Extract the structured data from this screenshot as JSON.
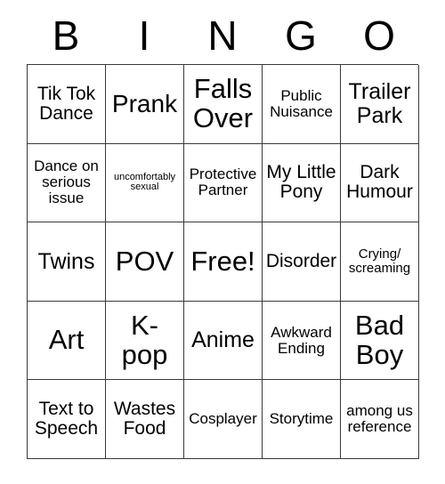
{
  "card": {
    "header_letters": [
      "B",
      "I",
      "N",
      "G",
      "O"
    ],
    "rows": [
      [
        {
          "text": "Tik Tok Dance",
          "size": "md"
        },
        {
          "text": "Prank",
          "size": "xl"
        },
        {
          "text": "Falls Over",
          "size": "xxl"
        },
        {
          "text": "Public Nuisance",
          "size": "sm"
        },
        {
          "text": "Trailer Park",
          "size": "lg"
        }
      ],
      [
        {
          "text": "Dance on serious issue",
          "size": "sm"
        },
        {
          "text": "uncomfortably sexual",
          "size": "xxs"
        },
        {
          "text": "Protective Partner",
          "size": "sm"
        },
        {
          "text": "My Little Pony",
          "size": "md"
        },
        {
          "text": "Dark Humour",
          "size": "md"
        }
      ],
      [
        {
          "text": "Twins",
          "size": "lg"
        },
        {
          "text": "POV",
          "size": "xxl"
        },
        {
          "text": "Free!",
          "size": "xxl"
        },
        {
          "text": "Disorder",
          "size": "md"
        },
        {
          "text": "Crying/ screaming",
          "size": "xs"
        }
      ],
      [
        {
          "text": "Art",
          "size": "xxl"
        },
        {
          "text": "K- pop",
          "size": "xxl"
        },
        {
          "text": "Anime",
          "size": "lg"
        },
        {
          "text": "Awkward Ending",
          "size": "sm"
        },
        {
          "text": "Bad Boy",
          "size": "xxl"
        }
      ],
      [
        {
          "text": "Text to Speech",
          "size": "md"
        },
        {
          "text": "Wastes Food",
          "size": "md"
        },
        {
          "text": "Cosplayer",
          "size": "sm"
        },
        {
          "text": "Storytime",
          "size": "sm"
        },
        {
          "text": "among us reference",
          "size": "sm"
        }
      ]
    ]
  }
}
